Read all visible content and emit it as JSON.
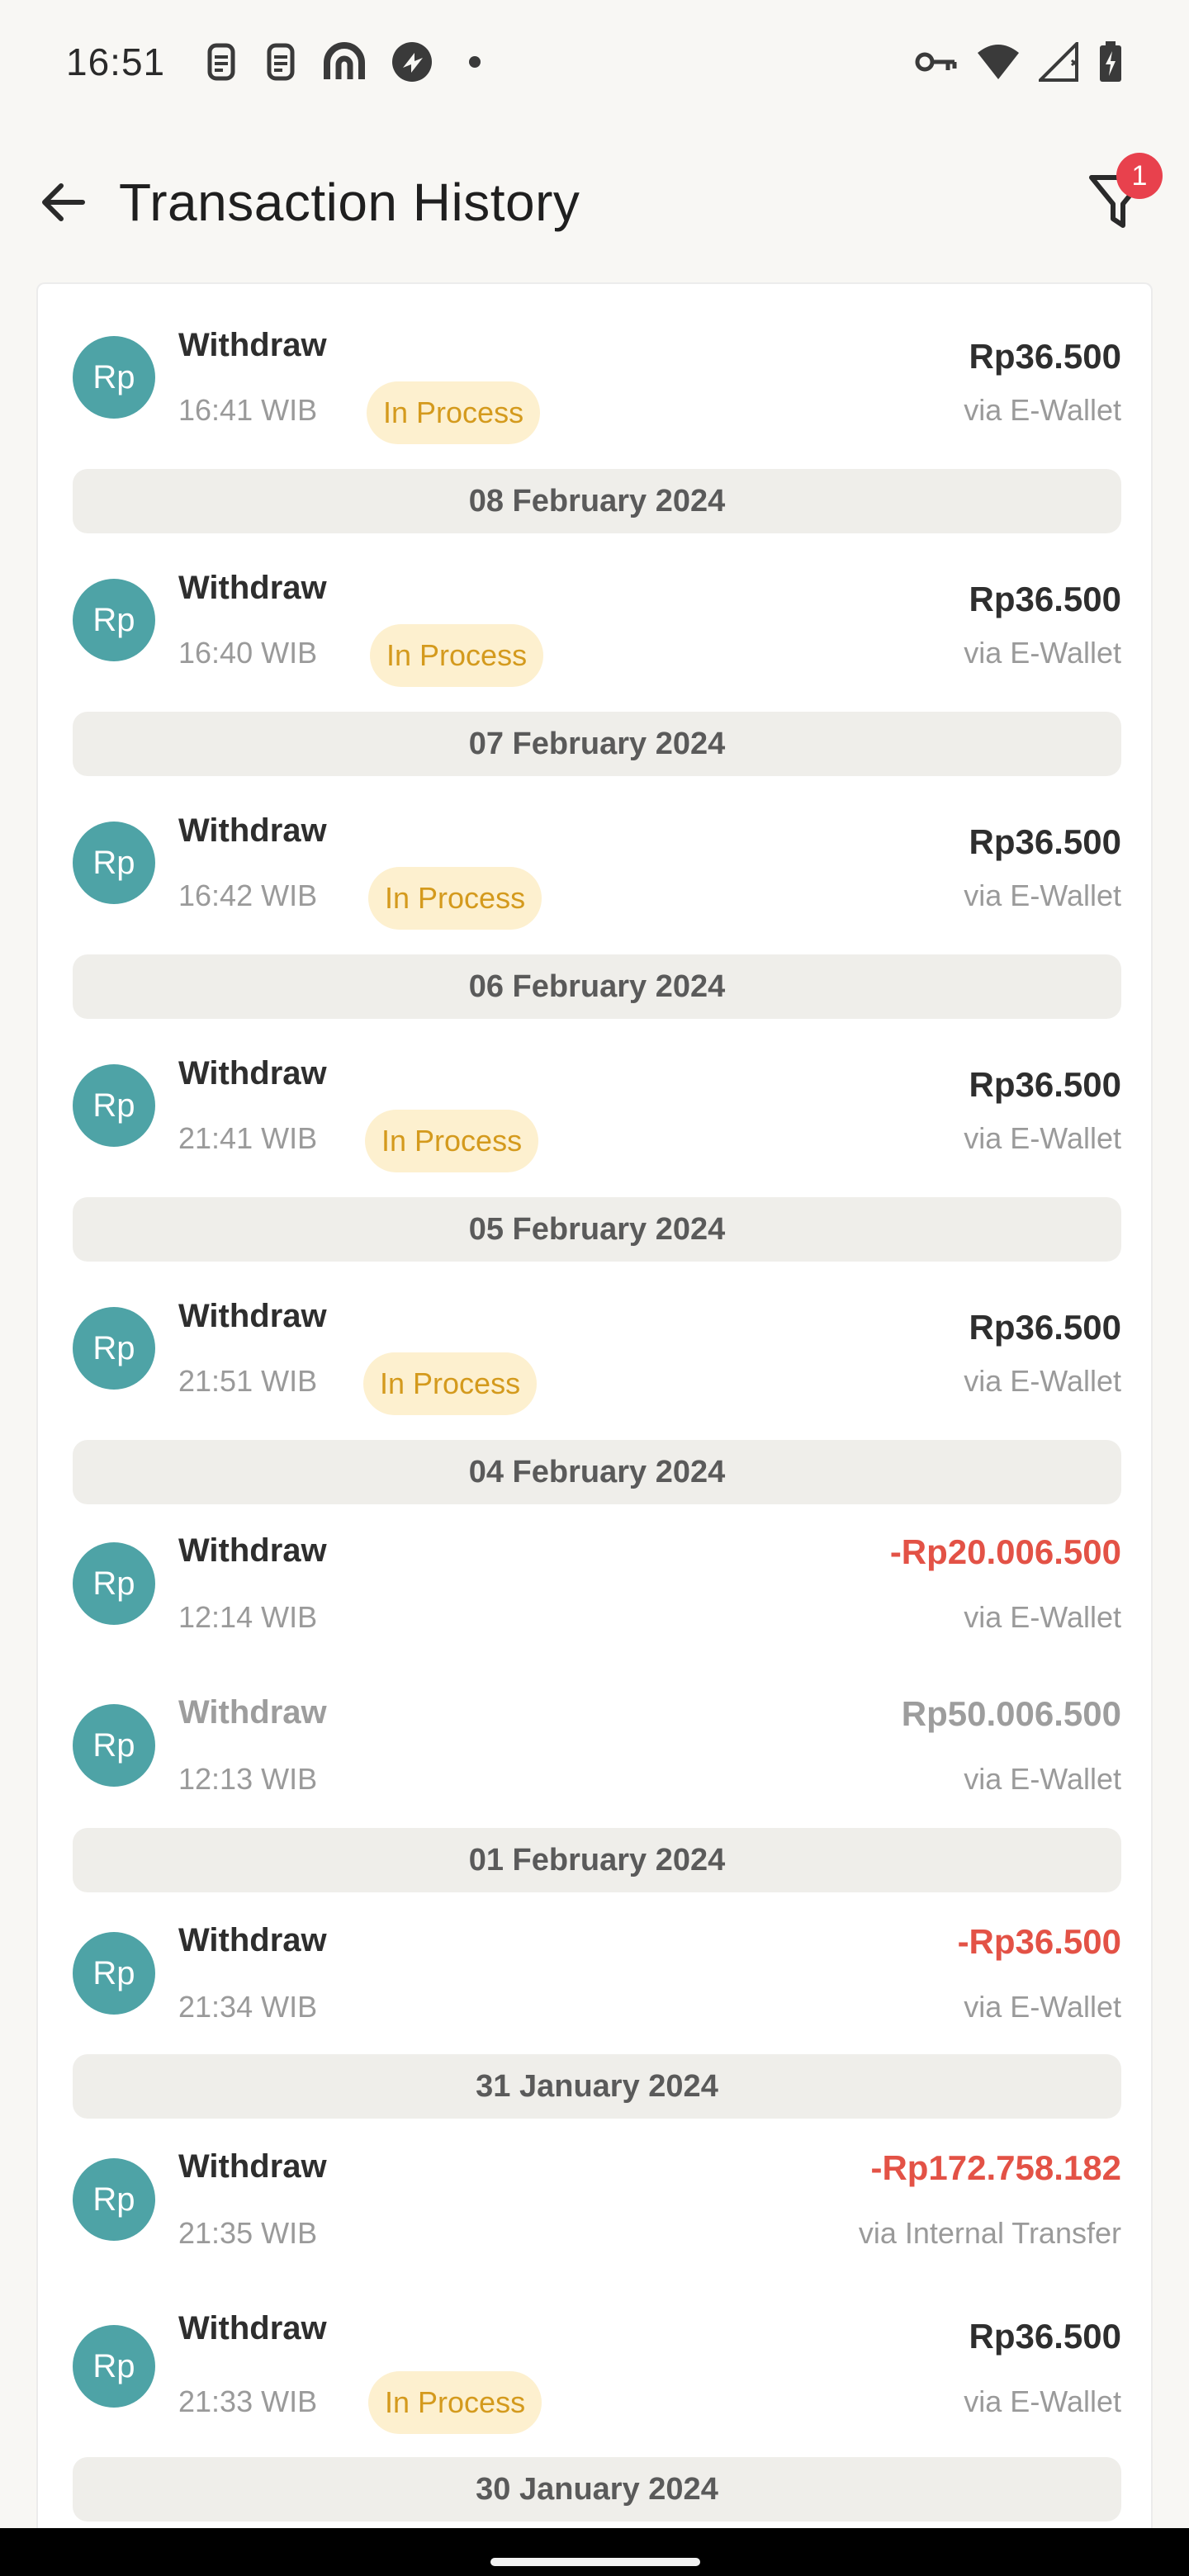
{
  "status_bar": {
    "time": "16:51",
    "left_icons": [
      "sim-card-icon",
      "sim-card-icon",
      "app-notification-icon",
      "app-notification-icon",
      "dot-icon"
    ],
    "right_icons": [
      "vpn-key-icon",
      "wifi-icon",
      "cell-signal-icon",
      "battery-charging-icon"
    ]
  },
  "header": {
    "title": "Transaction History",
    "filter_badge": "1"
  },
  "colors": {
    "avatar": "#4ea3a6",
    "pill_bg": "#fdf0cf",
    "pill_text": "#d49a1d",
    "negative": "#e35246",
    "badge": "#e8414d"
  },
  "transactions": [
    {
      "title": "Withdraw",
      "time": "16:41 WIB",
      "status": "In Process",
      "amount": "Rp36.500",
      "method": "via E-Wallet",
      "avatar": "Rp"
    },
    {
      "title": "Withdraw",
      "time": "16:40 WIB",
      "status": "In Process",
      "amount": "Rp36.500",
      "method": "via E-Wallet",
      "avatar": "Rp"
    },
    {
      "title": "Withdraw",
      "time": "16:42 WIB",
      "status": "In Process",
      "amount": "Rp36.500",
      "method": "via E-Wallet",
      "avatar": "Rp"
    },
    {
      "title": "Withdraw",
      "time": "21:41 WIB",
      "status": "In Process",
      "amount": "Rp36.500",
      "method": "via E-Wallet",
      "avatar": "Rp"
    },
    {
      "title": "Withdraw",
      "time": "21:51 WIB",
      "status": "In Process",
      "amount": "Rp36.500",
      "method": "via E-Wallet",
      "avatar": "Rp"
    },
    {
      "title": "Withdraw",
      "time": "12:14 WIB",
      "status": "",
      "amount": "-Rp20.006.500",
      "method": "via E-Wallet",
      "avatar": "Rp"
    },
    {
      "title": "Withdraw",
      "time": "12:13 WIB",
      "status": "",
      "amount": "Rp50.006.500",
      "method": "via E-Wallet",
      "avatar": "Rp"
    },
    {
      "title": "Withdraw",
      "time": "21:34 WIB",
      "status": "",
      "amount": "-Rp36.500",
      "method": "via E-Wallet",
      "avatar": "Rp"
    },
    {
      "title": "Withdraw",
      "time": "21:35 WIB",
      "status": "",
      "amount": "-Rp172.758.182",
      "method": "via Internal Transfer",
      "avatar": "Rp"
    },
    {
      "title": "Withdraw",
      "time": "21:33 WIB",
      "status": "In Process",
      "amount": "Rp36.500",
      "method": "via E-Wallet",
      "avatar": "Rp"
    }
  ],
  "dates": [
    "08 February 2024",
    "07 February 2024",
    "06 February 2024",
    "05 February 2024",
    "04 February 2024",
    "01 February 2024",
    "31 January 2024",
    "30 January 2024"
  ]
}
